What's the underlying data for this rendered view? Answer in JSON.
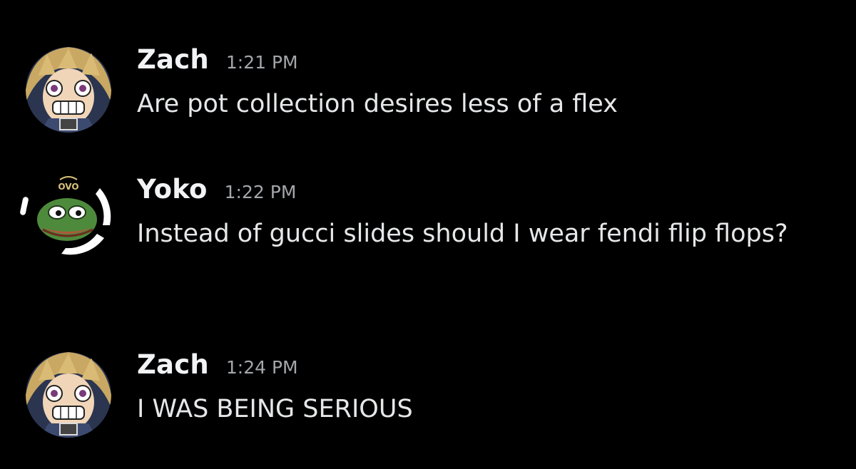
{
  "messages": [
    {
      "username": "Zach",
      "timestamp": "1:21 PM",
      "text": "Are pot collection desires less of a flex",
      "avatar": "anime-character-avatar"
    },
    {
      "username": "Yoko",
      "timestamp": "1:22 PM",
      "text": "Instead of gucci slides should I wear fendi flip flops?",
      "avatar": "pepe-frog-avatar",
      "avatar_badge": "OVO"
    },
    {
      "username": "Zach",
      "timestamp": "1:24 PM",
      "text": "I WAS BEING SERIOUS",
      "avatar": "anime-character-avatar"
    }
  ],
  "colors": {
    "background": "#000000",
    "username": "#f2f3f5",
    "timestamp": "#a3a6aa",
    "message_text": "#e6e7e9"
  }
}
